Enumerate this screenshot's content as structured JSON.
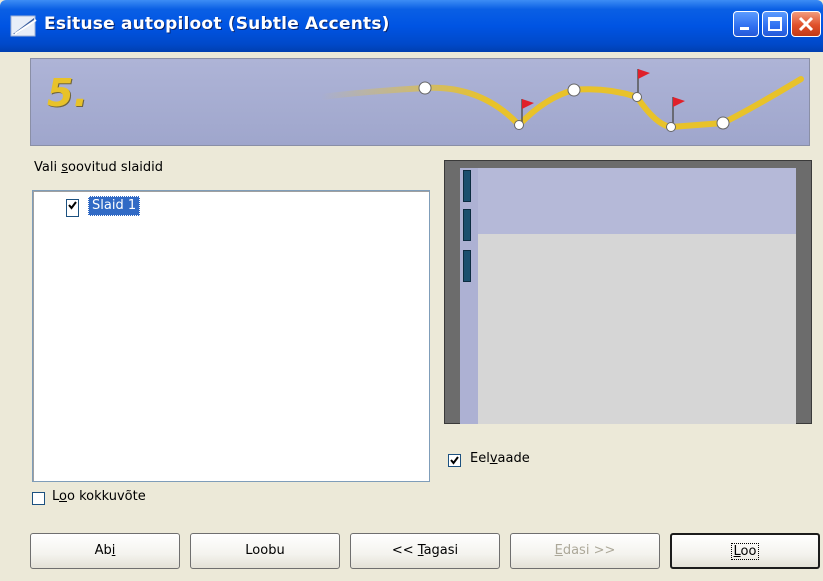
{
  "window": {
    "title": "Esituse autopiloot (Subtle Accents)"
  },
  "banner": {
    "step_number": "5."
  },
  "slides": {
    "label_pre": "Vali ",
    "label_u": "s",
    "label_post": "oovitud slaidid",
    "items": [
      {
        "label": "Slaid 1",
        "checked": true
      }
    ]
  },
  "preview": {
    "label_pre": "Eel",
    "label_u": "v",
    "label_post": "aade",
    "checked": true
  },
  "summary": {
    "label_pre": "L",
    "label_u": "o",
    "label_post": "o kokkuvõte",
    "checked": false
  },
  "buttons": {
    "help_pre": "Ab",
    "help_u": "i",
    "cancel": "Loobu",
    "back_pre": "<< ",
    "back_u": "T",
    "back_post": "agasi",
    "next_pre": "",
    "next_u": "E",
    "next_post": "dasi >>",
    "finish_pre": "",
    "finish_u": "L",
    "finish_post": "oo"
  },
  "colors": {
    "titlebar": "#0054e3",
    "selection": "#316ac5",
    "banner": "#aeb4d7",
    "path": "#e8c22a",
    "flag": "#e0202a"
  }
}
